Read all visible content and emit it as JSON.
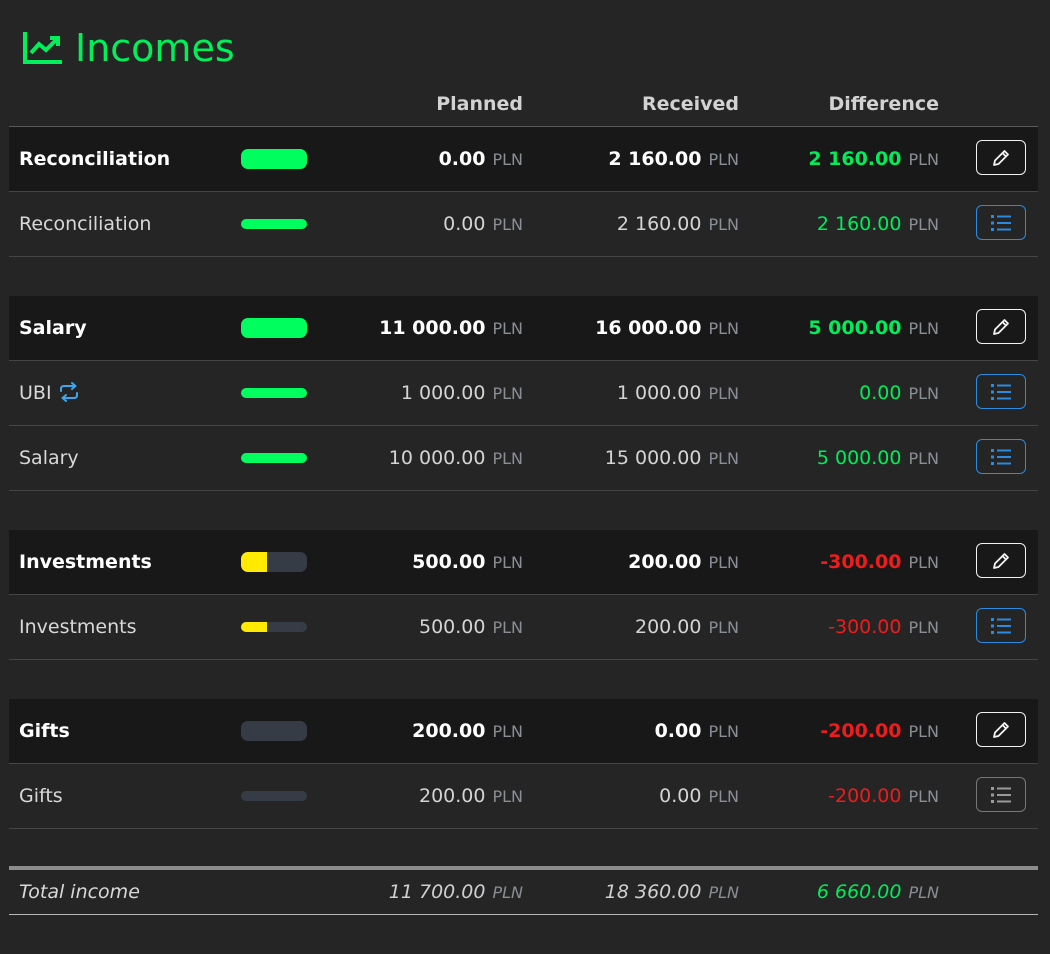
{
  "title": "Incomes",
  "columns": {
    "planned": "Planned",
    "received": "Received",
    "difference": "Difference"
  },
  "currency": "PLN",
  "colors": {
    "accent_green": "#00ef5b",
    "negative_red": "#ee1c1c",
    "bar_green": "#00ff5e",
    "bar_yellow": "#ffea00",
    "bar_track": "#363c46",
    "button_blue": "#2a8be0"
  },
  "groups": [
    {
      "name": "Reconciliation",
      "progress": 1.0,
      "planned": "0.00",
      "received": "2 160.00",
      "difference": "2 160.00",
      "categories": [
        {
          "name": "Reconciliation",
          "progress": 1.0,
          "planned": "0.00",
          "received": "2 160.00",
          "difference": "2 160.00",
          "recurring": false
        }
      ]
    },
    {
      "name": "Salary",
      "progress": 1.0,
      "planned": "11 000.00",
      "received": "16 000.00",
      "difference": "5 000.00",
      "categories": [
        {
          "name": "UBI",
          "progress": 1.0,
          "planned": "1 000.00",
          "received": "1 000.00",
          "difference": "0.00",
          "recurring": true
        },
        {
          "name": "Salary",
          "progress": 1.0,
          "planned": "10 000.00",
          "received": "15 000.00",
          "difference": "5 000.00",
          "recurring": false
        }
      ]
    },
    {
      "name": "Investments",
      "progress": 0.4,
      "planned": "500.00",
      "received": "200.00",
      "difference": "-300.00",
      "categories": [
        {
          "name": "Investments",
          "progress": 0.4,
          "planned": "500.00",
          "received": "200.00",
          "difference": "-300.00",
          "recurring": false
        }
      ]
    },
    {
      "name": "Gifts",
      "progress": 0.0,
      "planned": "200.00",
      "received": "0.00",
      "difference": "-200.00",
      "categories": [
        {
          "name": "Gifts",
          "progress": 0.0,
          "planned": "200.00",
          "received": "0.00",
          "difference": "-200.00",
          "recurring": false,
          "muted_button": true
        }
      ]
    }
  ],
  "total": {
    "label": "Total income",
    "planned": "11 700.00",
    "received": "18 360.00",
    "difference": "6 660.00"
  },
  "icons": {
    "title": "chart-line-icon",
    "edit": "pencil-icon",
    "list": "list-icon",
    "recurring": "repeat-icon"
  }
}
